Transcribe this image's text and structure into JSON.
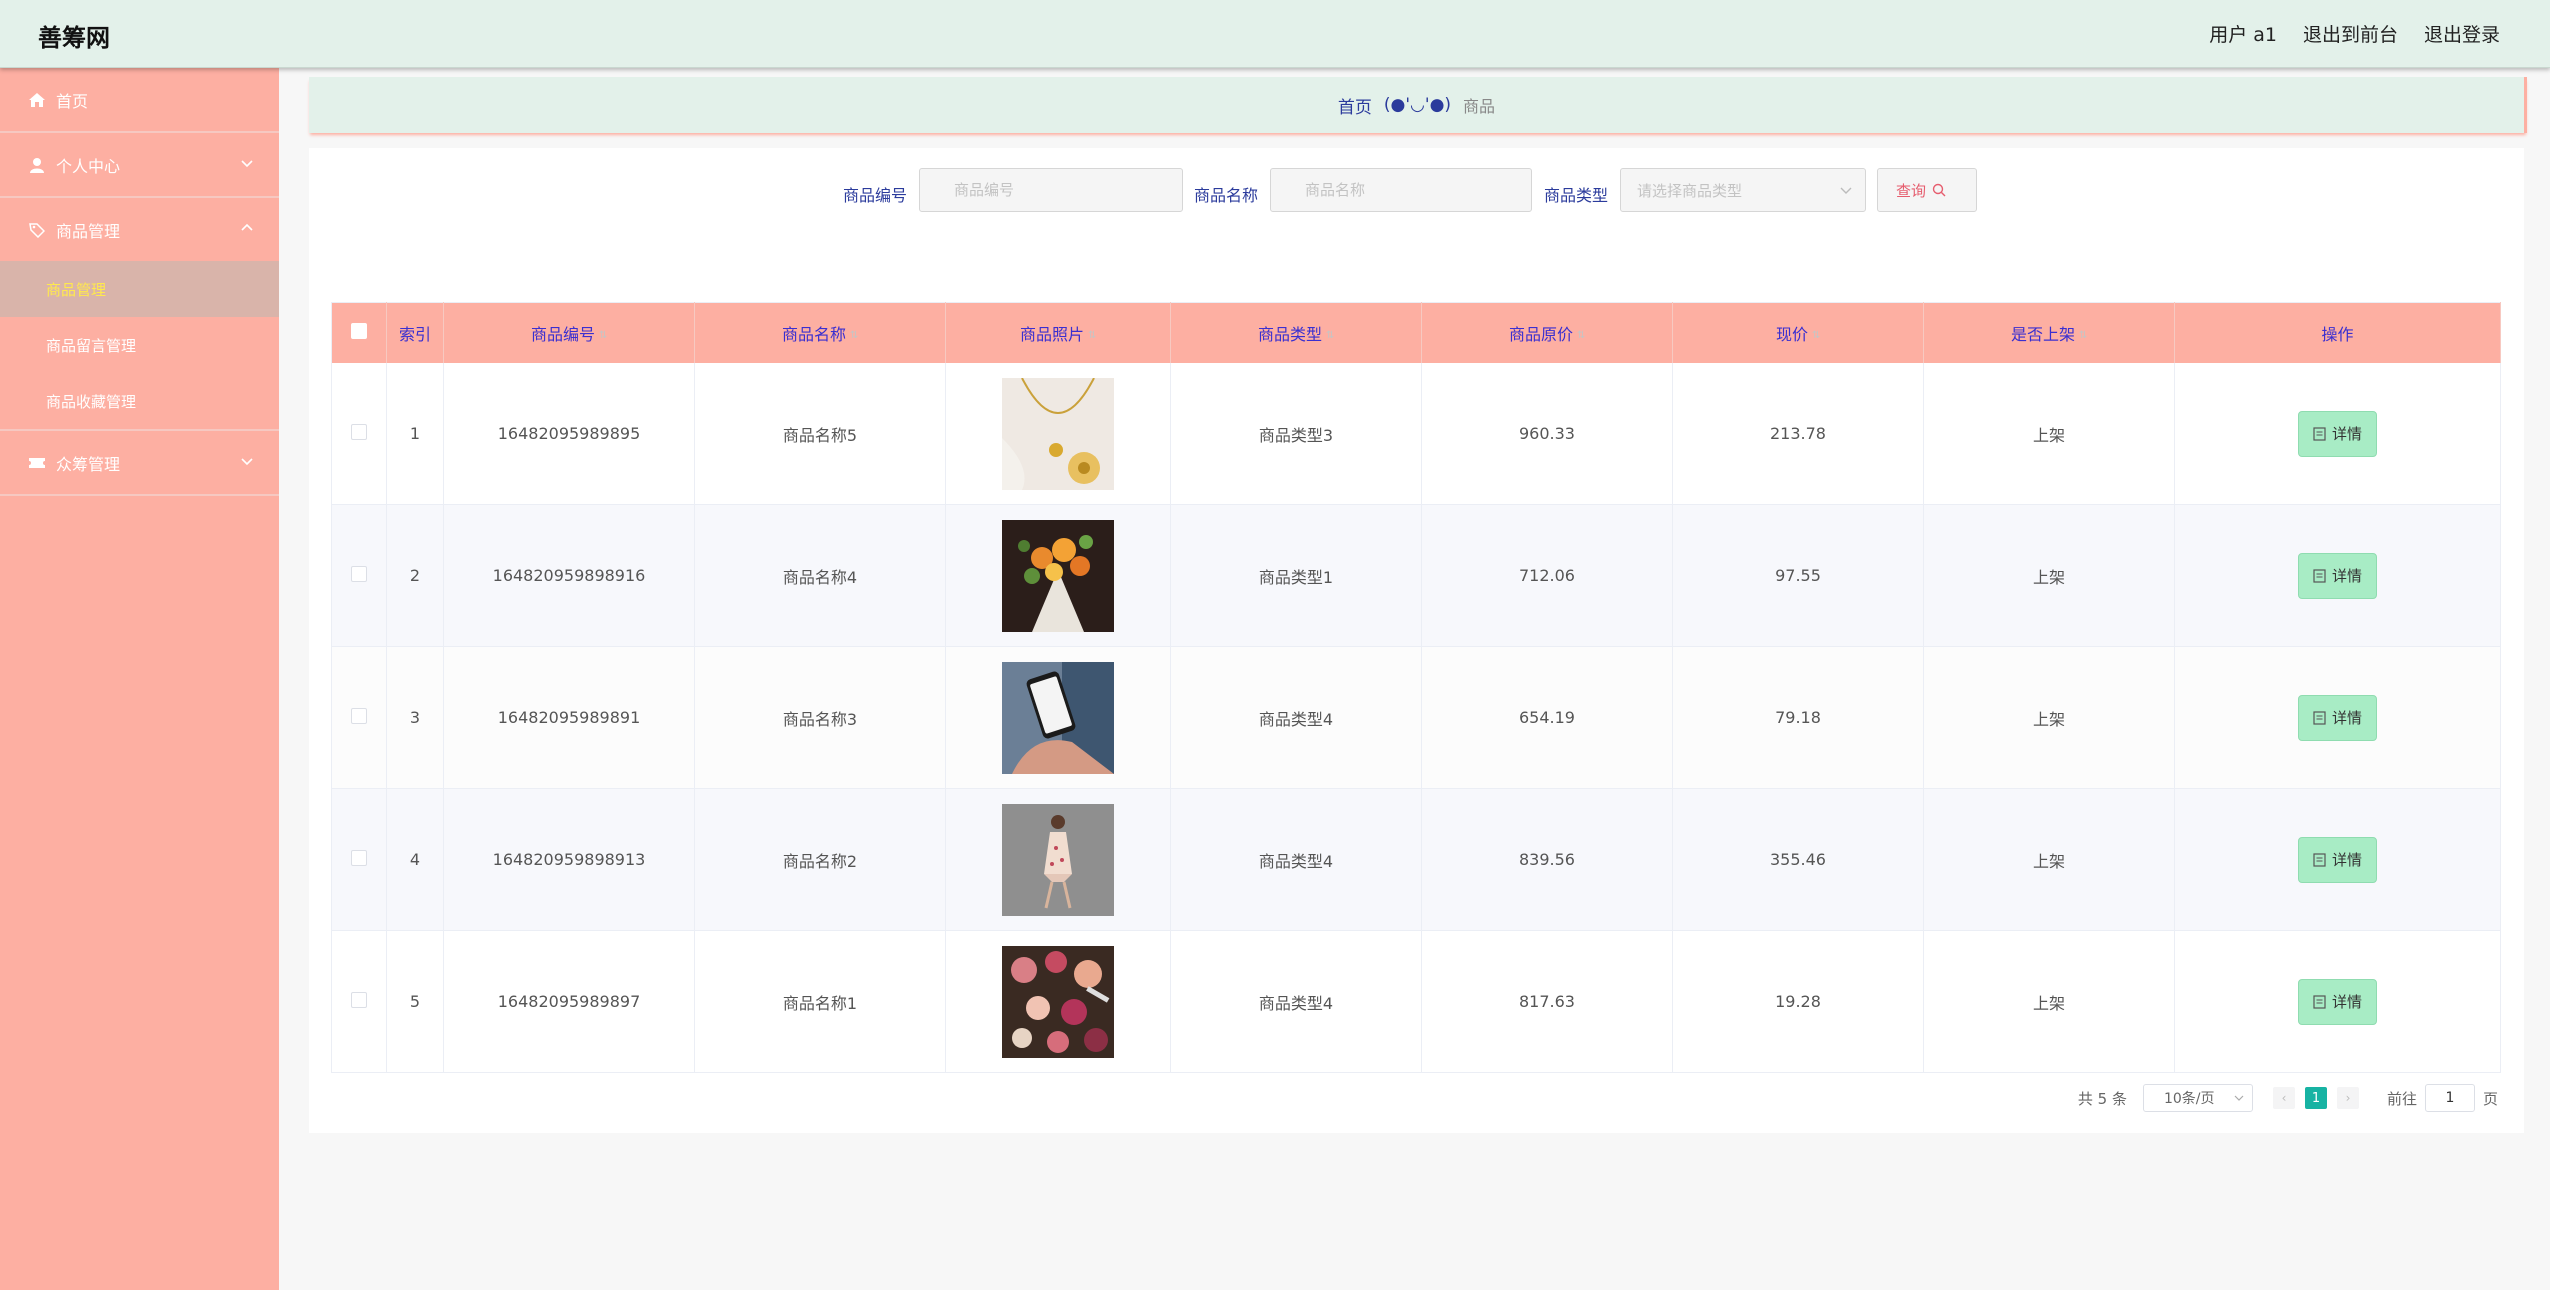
{
  "header": {
    "logo": "善筹网",
    "user": "用户 a1",
    "front_link": "退出到前台",
    "logout_link": "退出登录"
  },
  "sidebar": {
    "home": "首页",
    "personal": "个人中心",
    "goods_mgmt": "商品管理",
    "sub_items": [
      "商品管理",
      "商品留言管理",
      "商品收藏管理"
    ],
    "crowdfund": "众筹管理"
  },
  "breadcrumb": {
    "home": "首页",
    "face": "(●'◡'●)",
    "current": "商品"
  },
  "search": {
    "code_label": "商品编号",
    "code_placeholder": "商品编号",
    "name_label": "商品名称",
    "name_placeholder": "商品名称",
    "type_label": "商品类型",
    "type_placeholder": "请选择商品类型",
    "query_label": "查询"
  },
  "table": {
    "headers": [
      "索引",
      "商品编号",
      "商品名称",
      "商品照片",
      "商品类型",
      "商品原价",
      "现价",
      "是否上架",
      "操作"
    ],
    "detail_label": "详情",
    "rows": [
      {
        "idx": "1",
        "code": "16482095989895",
        "name": "商品名称5",
        "photo": "necklace",
        "type": "商品类型3",
        "orig": "960.33",
        "price": "213.78",
        "status": "上架"
      },
      {
        "idx": "2",
        "code": "164820959898916",
        "name": "商品名称4",
        "photo": "flowers",
        "type": "商品类型1",
        "orig": "712.06",
        "price": "97.55",
        "status": "上架"
      },
      {
        "idx": "3",
        "code": "16482095989891",
        "name": "商品名称3",
        "photo": "phone",
        "type": "商品类型4",
        "orig": "654.19",
        "price": "79.18",
        "status": "上架"
      },
      {
        "idx": "4",
        "code": "164820959898913",
        "name": "商品名称2",
        "photo": "dress",
        "type": "商品类型4",
        "orig": "839.56",
        "price": "355.46",
        "status": "上架"
      },
      {
        "idx": "5",
        "code": "16482095989897",
        "name": "商品名称1",
        "photo": "cosmetics",
        "type": "商品类型4",
        "orig": "817.63",
        "price": "19.28",
        "status": "上架"
      }
    ]
  },
  "pagination": {
    "total": "共 5 条",
    "page_size": "10条/页",
    "current_page": "1",
    "goto_label": "前往",
    "goto_value": "1",
    "page_suffix": "页"
  },
  "colors": {
    "sidebar_bg": "#fdafa2",
    "header_bg": "#e3f1ea",
    "accent_text": "#3a2fd0",
    "detail_btn": "#a8ecc5",
    "page_active": "#17b3a3"
  }
}
